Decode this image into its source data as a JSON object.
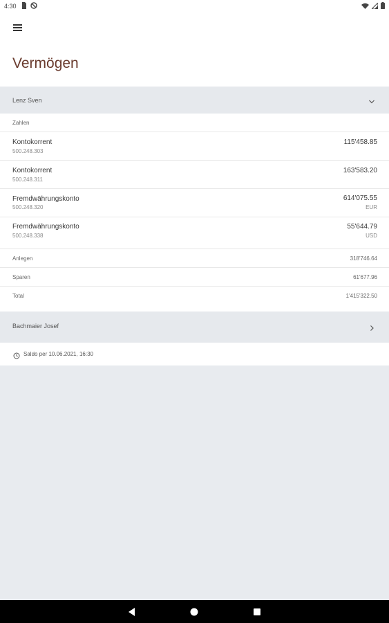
{
  "status_bar": {
    "time": "4:30",
    "left_icons": [
      "sd-card-icon",
      "blocked-icon"
    ],
    "right_icons": [
      "wifi-icon",
      "signal-icon",
      "battery-icon"
    ]
  },
  "app_bar": {
    "menu_icon": "hamburger-menu-icon"
  },
  "page": {
    "title": "Vermögen"
  },
  "groups": [
    {
      "name": "Lenz Sven",
      "expanded": true,
      "section_label": "Zahlen",
      "accounts": [
        {
          "name": "Kontokorrent",
          "number": "500.248.303",
          "amount": "115'458.85",
          "currency": ""
        },
        {
          "name": "Kontokorrent",
          "number": "500.248.311",
          "amount": "163'583.20",
          "currency": ""
        },
        {
          "name": "Fremdwährungskonto",
          "number": "500.248.320",
          "amount": "614'075.55",
          "currency": "EUR"
        },
        {
          "name": "Fremdwährungskonto",
          "number": "500.248.338",
          "amount": "55'644.79",
          "currency": "USD"
        }
      ],
      "summary": [
        {
          "label": "Anlegen",
          "amount": "318'746.64"
        },
        {
          "label": "Sparen",
          "amount": "61'677.96"
        },
        {
          "label": "Total",
          "amount": "1'415'322.50"
        }
      ]
    },
    {
      "name": "Bachmaier Josef",
      "expanded": false
    }
  ],
  "saldo": {
    "text": "Saldo per 10.06.2021, 16:30"
  },
  "nav_bar": {
    "buttons": [
      "back-icon",
      "home-icon",
      "recents-icon"
    ]
  },
  "colors": {
    "title": "#6a3b2e",
    "background": "#e8ebef",
    "header": "#e6e9ed"
  }
}
